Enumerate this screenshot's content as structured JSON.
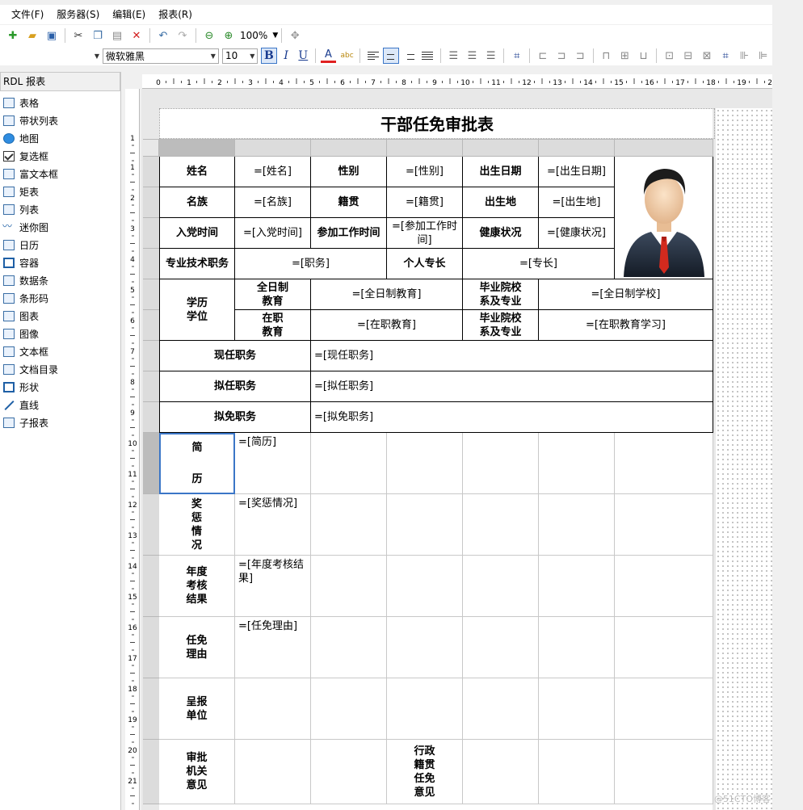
{
  "menu": [
    "文件(F)",
    "服务器(S)",
    "编辑(E)",
    "报表(R)"
  ],
  "toolbar": {
    "zoom": "100%"
  },
  "format": {
    "font_name": "微软雅黑",
    "font_size": "10",
    "bold": "B",
    "italic": "I",
    "underline": "U"
  },
  "sidebar": {
    "title": "RDL 报表",
    "items": [
      {
        "label": "表格",
        "icon": "table-icon"
      },
      {
        "label": "带状列表",
        "icon": "banded-list-icon"
      },
      {
        "label": "地图",
        "icon": "globe-icon"
      },
      {
        "label": "复选框",
        "icon": "checkbox-icon"
      },
      {
        "label": "富文本框",
        "icon": "rich-textbox-icon"
      },
      {
        "label": "矩表",
        "icon": "matrix-icon"
      },
      {
        "label": "列表",
        "icon": "list-icon"
      },
      {
        "label": "迷你图",
        "icon": "sparkline-icon"
      },
      {
        "label": "日历",
        "icon": "calendar-icon"
      },
      {
        "label": "容器",
        "icon": "container-icon"
      },
      {
        "label": "数据条",
        "icon": "databar-icon"
      },
      {
        "label": "条形码",
        "icon": "barcode-icon"
      },
      {
        "label": "图表",
        "icon": "chart-icon"
      },
      {
        "label": "图像",
        "icon": "image-icon"
      },
      {
        "label": "文本框",
        "icon": "textbox-icon"
      },
      {
        "label": "文档目录",
        "icon": "toc-icon"
      },
      {
        "label": "形状",
        "icon": "shape-icon"
      },
      {
        "label": "直线",
        "icon": "line-icon"
      },
      {
        "label": "子报表",
        "icon": "subreport-icon"
      }
    ]
  },
  "ruler": {
    "top": [
      "0",
      "1",
      "2",
      "3",
      "4",
      "5",
      "6",
      "7",
      "8",
      "9",
      "10",
      "11",
      "12",
      "13",
      "14",
      "15",
      "16",
      "17",
      "18",
      "19",
      "20"
    ],
    "left": [
      "1",
      "1",
      "2",
      "3",
      "4",
      "5",
      "6",
      "7",
      "8",
      "9",
      "10",
      "11",
      "12",
      "13",
      "14",
      "15",
      "16",
      "17",
      "18",
      "19",
      "20",
      "21"
    ]
  },
  "report": {
    "title": "干部任免审批表",
    "row1": [
      "姓名",
      "=[姓名]",
      "性别",
      "=[性别]",
      "出生日期",
      "=[出生日期]"
    ],
    "row2": [
      "名族",
      "=[名族]",
      "籍贯",
      "=[籍贯]",
      "出生地",
      "=[出生地]"
    ],
    "row3": [
      "入党时间",
      "=[入党时间]",
      "参加工作时间",
      "=[参加工作时间]",
      "健康状况",
      "=[健康状况]"
    ],
    "row4": [
      "专业技术职务",
      "=[职务]",
      "个人专长",
      "=[专长]"
    ],
    "edu": {
      "label": "学历\n学位",
      "ft_label": "全日制\n教育",
      "ft_value": "=[全日制教育]",
      "ft_school_label": "毕业院校\n系及专业",
      "ft_school_value": "=[全日制学校]",
      "pt_label": "在职\n教育",
      "pt_value": "=[在职教育]",
      "pt_school_label": "毕业院校\n系及专业",
      "pt_school_value": "=[在职教育学习]"
    },
    "duties": [
      {
        "label": "现任职务",
        "value": "=[现任职务]"
      },
      {
        "label": "拟任职务",
        "value": "=[拟任职务]"
      },
      {
        "label": "拟免职务",
        "value": "=[拟免职务]"
      }
    ],
    "sections": [
      {
        "label": "简\n\n\n历",
        "value": "=[简历]"
      },
      {
        "label": "奖\n惩\n情\n况",
        "value": "=[奖惩情况]"
      },
      {
        "label": "年度\n考核\n结果",
        "value": "=[年度考核结果]"
      },
      {
        "label": "任免\n理由",
        "value": "=[任免理由]"
      },
      {
        "label": "呈报\n单位",
        "value": ""
      },
      {
        "label": "审批\n机关\n意见",
        "value": ""
      }
    ],
    "admin_label": "行政\n籍贯\n任免\n意见"
  },
  "watermark": "@51CTO博客"
}
